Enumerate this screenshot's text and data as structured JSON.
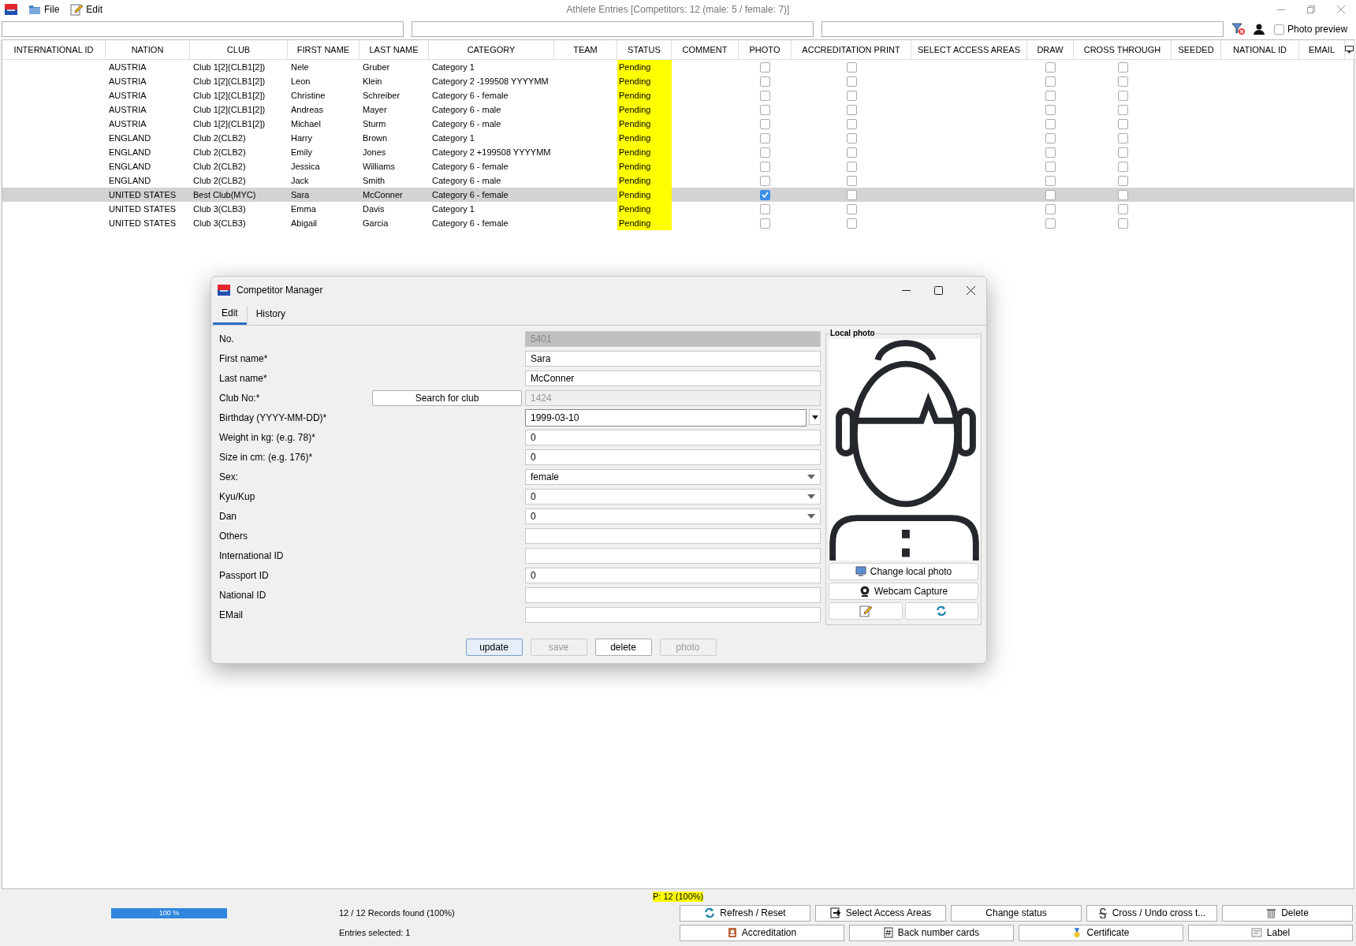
{
  "window": {
    "title": "Athlete Entries [Competitors: 12 (male: 5 / female: 7)]"
  },
  "menu": [
    {
      "label": "File"
    },
    {
      "label": "Edit"
    }
  ],
  "photo_preview": {
    "label": "Photo preview",
    "checked": false
  },
  "table": {
    "columns": [
      "INTERNATIONAL ID",
      "NATION",
      "CLUB",
      "FIRST NAME",
      "LAST NAME",
      "CATEGORY",
      "TEAM",
      "STATUS",
      "COMMENT",
      "PHOTO",
      "ACCREDITATION PRINT",
      "SELECT ACCESS AREAS",
      "DRAW",
      "CROSS THROUGH",
      "SEEDED",
      "NATIONAL ID",
      "EMAIL"
    ],
    "rows": [
      {
        "nation": "AUSTRIA",
        "club": "Club 1[2](CLB1[2])",
        "first_name": "Nele",
        "last_name": "Gruber",
        "category": "Category 1",
        "status": "Pending",
        "photo": false,
        "accreditation_print": false,
        "draw": false,
        "cross_through": false,
        "selected": false
      },
      {
        "nation": "AUSTRIA",
        "club": "Club 1[2](CLB1[2])",
        "first_name": "Leon",
        "last_name": "Klein",
        "category": "Category 2 -199508 YYYYMM",
        "status": "Pending",
        "photo": false,
        "accreditation_print": false,
        "draw": false,
        "cross_through": false,
        "selected": false
      },
      {
        "nation": "AUSTRIA",
        "club": "Club 1[2](CLB1[2])",
        "first_name": "Christine",
        "last_name": "Schreiber",
        "category": "Category 6 - female",
        "status": "Pending",
        "photo": false,
        "accreditation_print": false,
        "draw": false,
        "cross_through": false,
        "selected": false
      },
      {
        "nation": "AUSTRIA",
        "club": "Club 1[2](CLB1[2])",
        "first_name": "Andreas",
        "last_name": "Mayer",
        "category": "Category 6 - male",
        "status": "Pending",
        "photo": false,
        "accreditation_print": false,
        "draw": false,
        "cross_through": false,
        "selected": false
      },
      {
        "nation": "AUSTRIA",
        "club": "Club 1[2](CLB1[2])",
        "first_name": "Michael",
        "last_name": "Sturm",
        "category": "Category 6 - male",
        "status": "Pending",
        "photo": false,
        "accreditation_print": false,
        "draw": false,
        "cross_through": false,
        "selected": false
      },
      {
        "nation": "ENGLAND",
        "club": "Club 2(CLB2)",
        "first_name": "Harry",
        "last_name": "Brown",
        "category": "Category 1",
        "status": "Pending",
        "photo": false,
        "accreditation_print": false,
        "draw": false,
        "cross_through": false,
        "selected": false
      },
      {
        "nation": "ENGLAND",
        "club": "Club 2(CLB2)",
        "first_name": "Emily",
        "last_name": "Jones",
        "category": "Category 2 +199508 YYYYMM",
        "status": "Pending",
        "photo": false,
        "accreditation_print": false,
        "draw": false,
        "cross_through": false,
        "selected": false
      },
      {
        "nation": "ENGLAND",
        "club": "Club 2(CLB2)",
        "first_name": "Jessica",
        "last_name": "Williams",
        "category": "Category 6 - female",
        "status": "Pending",
        "photo": false,
        "accreditation_print": false,
        "draw": false,
        "cross_through": false,
        "selected": false
      },
      {
        "nation": "ENGLAND",
        "club": "Club 2(CLB2)",
        "first_name": "Jack",
        "last_name": "Smith",
        "category": "Category 6 - male",
        "status": "Pending",
        "photo": false,
        "accreditation_print": false,
        "draw": false,
        "cross_through": false,
        "selected": false
      },
      {
        "nation": "UNITED STATES",
        "club": "Best Club(MYC)",
        "first_name": "Sara",
        "last_name": "McConner",
        "category": "Category 6 - female",
        "status": "Pending",
        "photo": true,
        "accreditation_print": false,
        "draw": false,
        "cross_through": false,
        "selected": true
      },
      {
        "nation": "UNITED STATES",
        "club": "Club 3(CLB3)",
        "first_name": "Emma",
        "last_name": "Davis",
        "category": "Category 1",
        "status": "Pending",
        "photo": false,
        "accreditation_print": false,
        "draw": false,
        "cross_through": false,
        "selected": false
      },
      {
        "nation": "UNITED STATES",
        "club": "Club 3(CLB3)",
        "first_name": "Abigail",
        "last_name": "Garcia",
        "category": "Category 6 - female",
        "status": "Pending",
        "photo": false,
        "accreditation_print": false,
        "draw": false,
        "cross_through": false,
        "selected": false
      }
    ]
  },
  "dialog": {
    "title": "Competitor Manager",
    "tabs": [
      {
        "label": "Edit",
        "selected": true
      },
      {
        "label": "History",
        "selected": false
      }
    ],
    "fields": [
      {
        "label": "No.",
        "kind": "text",
        "value": "5401",
        "disabled": true
      },
      {
        "label": "First name*",
        "kind": "text",
        "value": "Sara",
        "disabled": false
      },
      {
        "label": "Last name*",
        "kind": "text",
        "value": "McConner",
        "disabled": false
      },
      {
        "label": "Club No:*",
        "kind": "club",
        "button": "Search for club",
        "value": "1424",
        "disabled": true
      },
      {
        "label": "Birthday (YYYY-MM-DD)*",
        "kind": "date",
        "value": "1999-03-10",
        "disabled": false
      },
      {
        "label": "Weight in kg: (e.g. 78)*",
        "kind": "text",
        "value": "0",
        "disabled": false
      },
      {
        "label": "Size in cm: (e.g. 176)*",
        "kind": "text",
        "value": "0",
        "disabled": false
      },
      {
        "label": "Sex:",
        "kind": "select",
        "value": "female",
        "disabled": false
      },
      {
        "label": "Kyu/Kup",
        "kind": "select",
        "value": "0",
        "disabled": false
      },
      {
        "label": "Dan",
        "kind": "select",
        "value": "0",
        "disabled": false
      },
      {
        "label": "Others",
        "kind": "text",
        "disabled": false
      },
      {
        "label": "International ID",
        "kind": "text",
        "disabled": false
      },
      {
        "label": "Passport ID",
        "kind": "text",
        "value": "0",
        "disabled": false
      },
      {
        "label": "National ID",
        "kind": "text",
        "disabled": false
      },
      {
        "label": "EMail",
        "kind": "text",
        "disabled": false
      }
    ],
    "photo_panel": {
      "title": "Local photo",
      "buttons": [
        {
          "label": "Change local photo"
        },
        {
          "label": "Webcam Capture"
        }
      ]
    },
    "actions": [
      {
        "label": "update",
        "default": true,
        "disabled": false
      },
      {
        "label": "save",
        "default": false,
        "disabled": true
      },
      {
        "label": "delete",
        "default": false,
        "disabled": false
      },
      {
        "label": "photo",
        "default": false,
        "disabled": true
      }
    ]
  },
  "footer": {
    "highlight": "P: 12 (100%)",
    "progress": {
      "level": 1,
      "label": "100 %"
    },
    "records": "12 / 12 Records found (100%)",
    "selected_count": "Entries selected: 1",
    "buttons": [
      "Refresh / Reset",
      "Select Access Areas",
      "Change status",
      "Cross / Undo cross t...",
      "Delete"
    ],
    "buttons_2": [
      "Accreditation",
      "Back number cards",
      "Certificate",
      "Label"
    ]
  }
}
